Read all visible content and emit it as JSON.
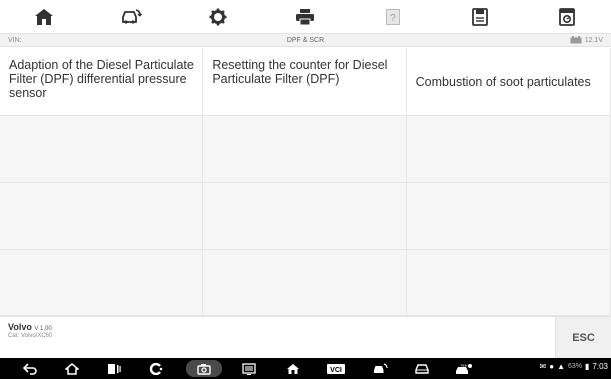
{
  "toolbar": {
    "items": [
      {
        "icon": "home-icon"
      },
      {
        "icon": "vehicle-swap-icon"
      },
      {
        "icon": "settings-gear-icon"
      },
      {
        "icon": "print-icon"
      },
      {
        "icon": "help-icon"
      },
      {
        "icon": "save-icon"
      },
      {
        "icon": "data-logging-icon"
      }
    ]
  },
  "info": {
    "vin_label": "VIN:",
    "title": "DPF & SCR",
    "battery_voltage": "12.1V"
  },
  "functions": [
    "Adaption of the Diesel Particulate Filter (DPF) differential pressure sensor",
    "Resetting the counter for Diesel Particulate Filter (DPF)",
    "Combustion of soot particulates"
  ],
  "bottom": {
    "make": "Volvo",
    "version": "V 1.00",
    "car": "Car: Volvo/XC60",
    "esc_label": "ESC"
  },
  "status": {
    "battery_percent": "63%",
    "time": "7:03"
  },
  "colors": {
    "toolbar_icons": "#333333",
    "grid_background": "#f6f6f6",
    "nav_bar": "#000000"
  }
}
